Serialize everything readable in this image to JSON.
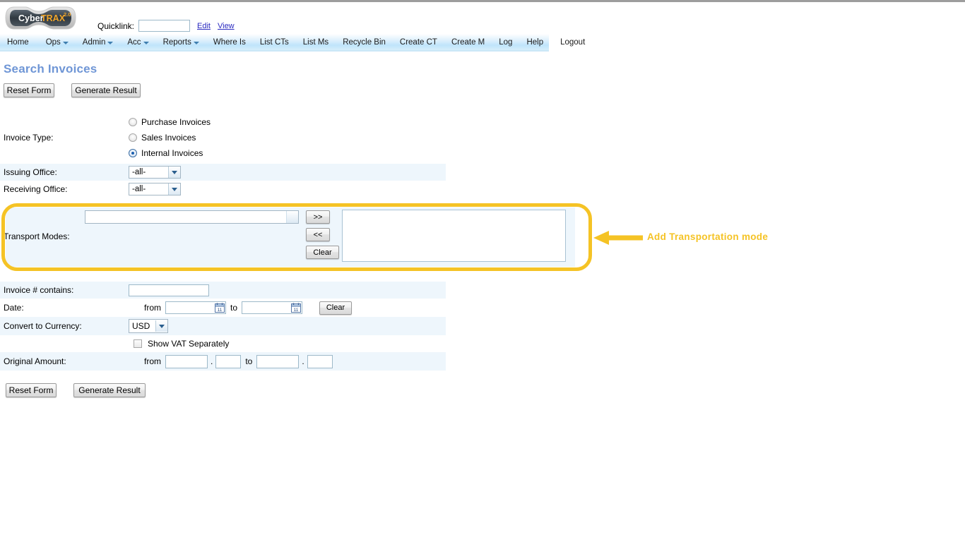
{
  "brand": {
    "name_part1": "Cyber",
    "name_part2": "TRAX",
    "version": "2.0"
  },
  "header": {
    "quicklink_label": "Quicklink:",
    "quicklink_value": "",
    "quicklink_placeholder": "",
    "edit_link": "Edit",
    "view_link": "View"
  },
  "nav": {
    "items": [
      {
        "label": "Home",
        "has_caret": false
      },
      {
        "label": "Ops",
        "has_caret": true
      },
      {
        "label": "Admin",
        "has_caret": true
      },
      {
        "label": "Acc",
        "has_caret": true
      },
      {
        "label": "Reports",
        "has_caret": true
      },
      {
        "label": "Where Is",
        "has_caret": false
      },
      {
        "label": "List CTs",
        "has_caret": false
      },
      {
        "label": "List Ms",
        "has_caret": false
      },
      {
        "label": "Recycle Bin",
        "has_caret": false
      },
      {
        "label": "Create CT",
        "has_caret": false
      },
      {
        "label": "Create M",
        "has_caret": false
      },
      {
        "label": "Log",
        "has_caret": false
      },
      {
        "label": "Help",
        "has_caret": false
      },
      {
        "label": "Logout",
        "has_caret": false
      }
    ]
  },
  "page": {
    "title": "Search Invoices",
    "title_color": "#6f96d6"
  },
  "toolbar": {
    "reset_label": "Reset Form",
    "generate_label": "Generate Result"
  },
  "form": {
    "invoice_type": {
      "label": "Invoice Type:",
      "options": [
        {
          "label": "Purchase Invoices",
          "selected": false
        },
        {
          "label": "Sales Invoices",
          "selected": false
        },
        {
          "label": "Internal Invoices",
          "selected": true
        }
      ]
    },
    "issuing_office": {
      "label": "Issuing Office:",
      "value": "-all-"
    },
    "receiving_office": {
      "label": "Receiving Office:",
      "value": "-all-"
    },
    "transport_modes": {
      "label": "Transport Modes:",
      "select_value": "",
      "add_label": ">>",
      "remove_label": "<<",
      "clear_label": "Clear",
      "selected_items": []
    },
    "invoice_contains": {
      "label": "Invoice # contains:",
      "value": ""
    },
    "date": {
      "label": "Date:",
      "from_label": "from",
      "to_label": "to",
      "from_value": "",
      "to_value": "",
      "clear_label": "Clear",
      "calendar_icon": "calendar-icon"
    },
    "currency": {
      "label": "Convert to Currency:",
      "value": "USD"
    },
    "show_vat": {
      "label": "Show VAT Separately",
      "checked": false
    },
    "original_amount": {
      "label": "Original Amount:",
      "from_label": "from",
      "to_label": "to",
      "from_whole": "",
      "from_frac": "",
      "to_whole": "",
      "to_frac": "",
      "separator": "."
    }
  },
  "annotation": {
    "text": "Add Transportation mode",
    "color": "#F5C325"
  }
}
